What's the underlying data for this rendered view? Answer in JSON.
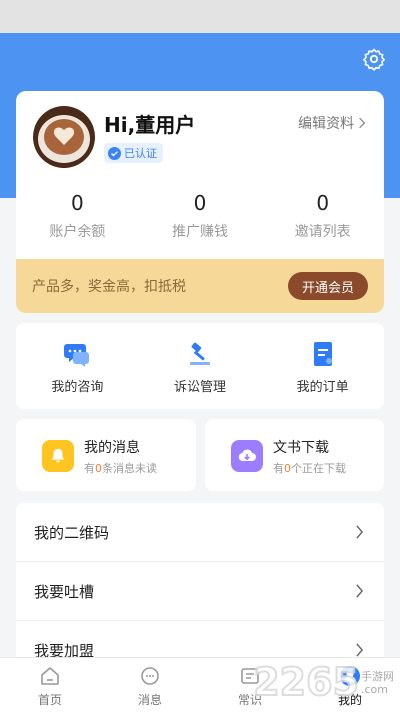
{
  "profile": {
    "greeting": "Hi,董用户",
    "verified_label": "已认证",
    "edit_label": "编辑资料"
  },
  "stats": [
    {
      "value": "0",
      "label": "账户余额"
    },
    {
      "value": "0",
      "label": "推广赚钱"
    },
    {
      "value": "0",
      "label": "邀请列表"
    }
  ],
  "promo": {
    "text": "产品多，奖金高，扣抵税",
    "button": "开通会员"
  },
  "quick_actions": [
    {
      "label": "我的咨询",
      "icon": "chat-bubble-icon"
    },
    {
      "label": "诉讼管理",
      "icon": "gavel-icon"
    },
    {
      "label": "我的订单",
      "icon": "order-document-icon"
    }
  ],
  "messages": {
    "title": "我的消息",
    "prefix": "有",
    "count": "0",
    "suffix": "条消息未读"
  },
  "downloads": {
    "title": "文书下载",
    "prefix": "有",
    "count": "0",
    "suffix": "个正在下载"
  },
  "menu": [
    {
      "label": "我的二维码"
    },
    {
      "label": "我要吐槽"
    },
    {
      "label": "我要加盟"
    }
  ],
  "tabs": [
    {
      "label": "首页",
      "icon": "home-icon"
    },
    {
      "label": "消息",
      "icon": "message-icon"
    },
    {
      "label": "常识",
      "icon": "knowledge-icon"
    },
    {
      "label": "我的",
      "icon": "profile-icon",
      "active": true
    }
  ],
  "watermark": {
    "big": "2265",
    "small1": "手游网",
    "small2": ".com"
  },
  "colors": {
    "header_blue": "#4d93f1",
    "promo_gold": "#f6d998",
    "promo_button": "#8b4a2c",
    "highlight_orange": "#ff7a2e"
  }
}
